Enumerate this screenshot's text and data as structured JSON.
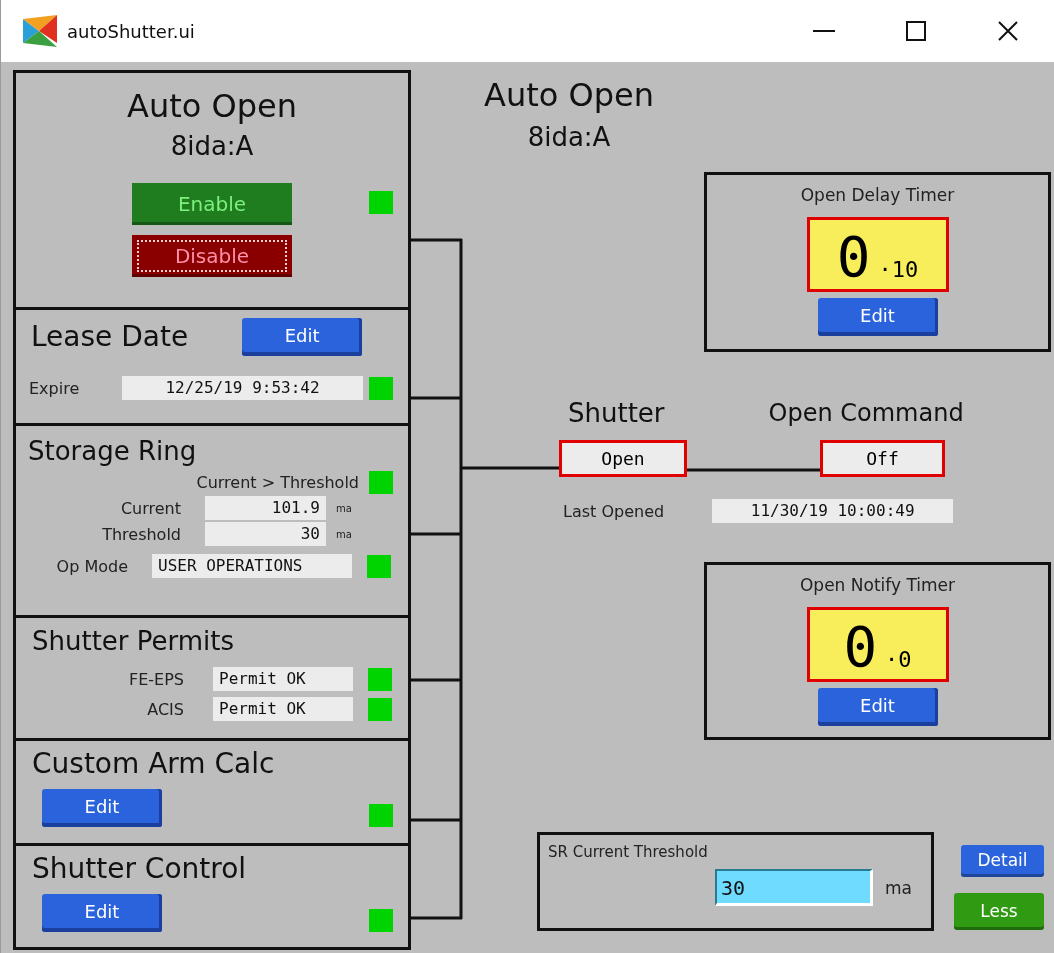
{
  "window": {
    "title": "autoShutter.ui"
  },
  "panels": [
    {
      "kind": "auto_open",
      "title": "Auto Open",
      "subtitle": "8ida:A",
      "buttons": [
        {
          "label": "Enable",
          "kind": "enable",
          "focused": false
        },
        {
          "label": "Disable",
          "kind": "disable",
          "focused": true
        }
      ],
      "ok": true
    },
    {
      "kind": "lease",
      "title": "Lease Date",
      "edit": "Edit",
      "fields": [
        {
          "label": "Expire",
          "value": "12/25/19 9:53:42",
          "ok": true
        }
      ]
    },
    {
      "kind": "storage",
      "title": "Storage Ring",
      "status": {
        "label": "Current > Threshold",
        "ok": true
      },
      "readings": [
        {
          "label": "Current",
          "value": "101.9",
          "unit": "ma"
        },
        {
          "label": "Threshold",
          "value": "30",
          "unit": "ma"
        }
      ],
      "fields": [
        {
          "label": "Op Mode",
          "value": "USER OPERATIONS",
          "ok": true
        }
      ]
    },
    {
      "kind": "permits",
      "title": "Shutter Permits",
      "fields": [
        {
          "label": "FE-EPS",
          "value": "Permit OK",
          "ok": true
        },
        {
          "label": "ACIS",
          "value": "Permit OK",
          "ok": true
        }
      ]
    },
    {
      "kind": "edit",
      "title": "Custom Arm Calc",
      "edit": "Edit",
      "ok": true
    },
    {
      "kind": "edit",
      "title": "Shutter Control",
      "edit": "Edit",
      "ok": true
    }
  ],
  "display": {
    "title": "Auto Open",
    "subtitle": "8ida:A"
  },
  "timers": [
    {
      "title": "Open Delay Timer",
      "value": "0",
      "fraction": "·10",
      "alarm": true,
      "edit": "Edit"
    },
    {
      "title": "Open Notify Timer",
      "value": "0",
      "fraction": "·0",
      "alarm": true,
      "edit": "Edit"
    }
  ],
  "shutter": {
    "label": "Shutter",
    "state": "Open",
    "alarm": true,
    "last_opened_label": "Last Opened",
    "last_opened": "11/30/19 10:00:49"
  },
  "open_command": {
    "label": "Open Command",
    "state": "Off",
    "alarm": true
  },
  "threshold_setting": {
    "title": "SR Current Threshold",
    "value": "30",
    "unit": "ma"
  },
  "buttons": [
    {
      "label": "Detail",
      "kind": "detail"
    },
    {
      "label": "Less",
      "kind": "less"
    }
  ]
}
